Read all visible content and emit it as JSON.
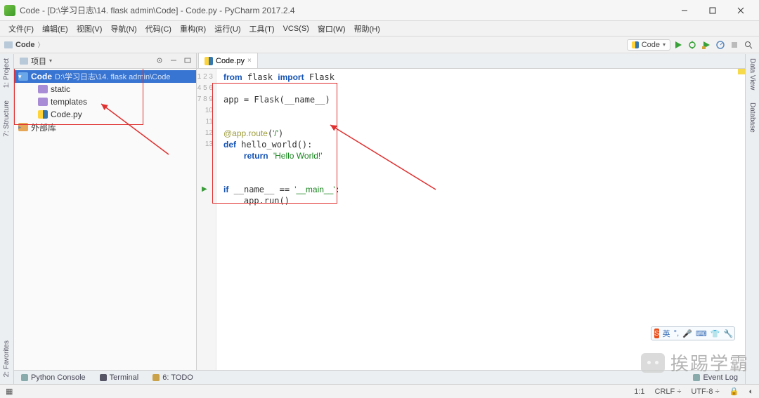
{
  "window": {
    "title": "Code - [D:\\学习日志\\14. flask admin\\Code] - Code.py - PyCharm 2017.2.4"
  },
  "menu": [
    "文件(F)",
    "编辑(E)",
    "视图(V)",
    "导航(N)",
    "代码(C)",
    "重构(R)",
    "运行(U)",
    "工具(T)",
    "VCS(S)",
    "窗口(W)",
    "帮助(H)"
  ],
  "breadcrumb": {
    "root": "Code"
  },
  "runConfig": {
    "label": "Code"
  },
  "projectPanel": {
    "selectorLabel": "项目",
    "tree": {
      "root": {
        "name": "Code",
        "path": "D:\\学习日志\\14. flask admin\\Code"
      },
      "children": [
        {
          "name": "static",
          "type": "folder"
        },
        {
          "name": "templates",
          "type": "folder"
        },
        {
          "name": "Code.py",
          "type": "pyfile"
        }
      ],
      "external": "外部库"
    }
  },
  "editor": {
    "tab": "Code.py",
    "lines": [
      "from flask import Flask",
      "",
      "app = Flask(__name__)",
      "",
      "",
      "@app.route('/')",
      "def hello_world():",
      "    return 'Hello World!'",
      "",
      "",
      "if __name__ == '__main__':",
      "    app.run()",
      ""
    ]
  },
  "bottom": {
    "pythonConsole": "Python Console",
    "terminal": "Terminal",
    "todo": "TODO",
    "eventLog": "Event Log"
  },
  "status": {
    "pos": "1:1",
    "lineSep": "CRLF",
    "encoding": "UTF-8"
  },
  "sideTools": {
    "left": [
      "1: Project",
      "7: Structure",
      "2: Favorites"
    ],
    "right": [
      "Data View",
      "Database"
    ]
  },
  "ime": {
    "label": "英"
  },
  "watermark": "挨踢学霸"
}
